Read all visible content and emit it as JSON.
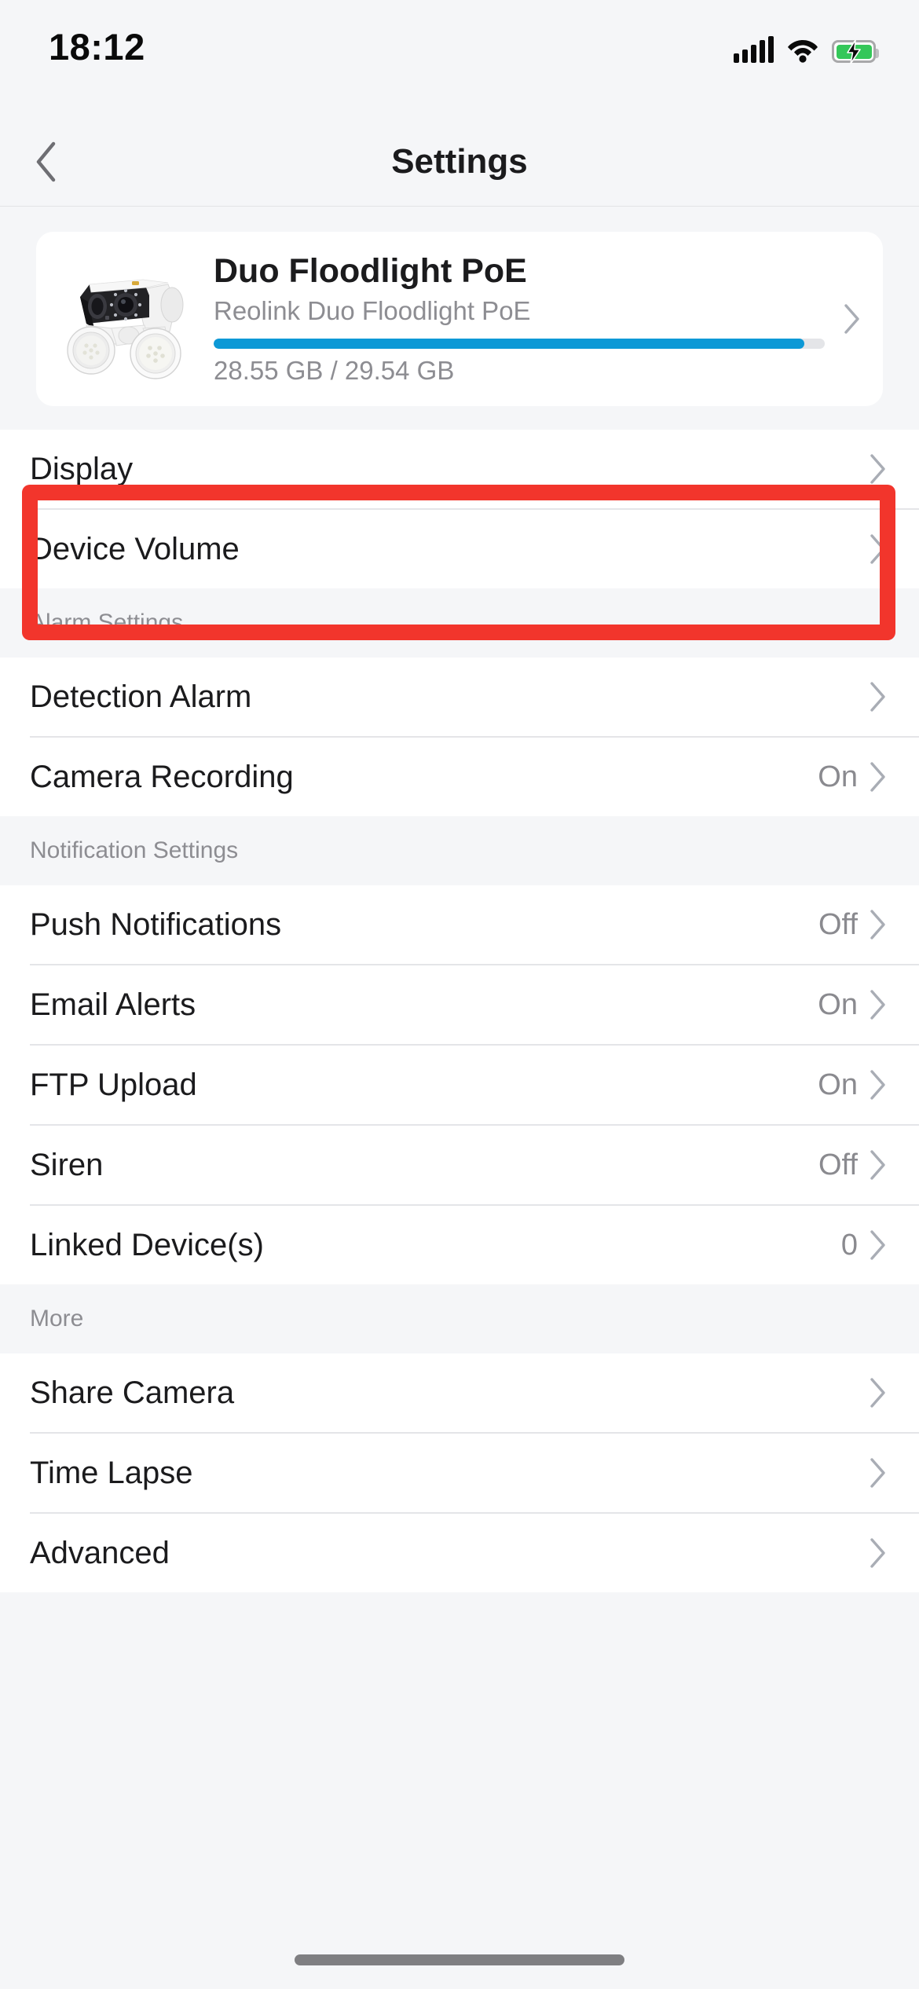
{
  "status_bar": {
    "time": "18:12",
    "signal_icon": "cellular-signal-icon",
    "wifi_icon": "wifi-icon",
    "battery_icon": "battery-charging-icon",
    "battery_color": "#34c759"
  },
  "navbar": {
    "back_icon": "chevron-left-icon",
    "title": "Settings"
  },
  "device_card": {
    "image_alt": "camera-thumbnail",
    "name": "Duo Floodlight PoE",
    "model": "Reolink Duo Floodlight PoE",
    "storage_used": "28.55 GB",
    "storage_total": "29.54 GB",
    "storage_text": "28.55 GB / 29.54 GB",
    "storage_percent": 96.6,
    "bar_color": "#0d99d6",
    "chevron_icon": "chevron-right-icon"
  },
  "highlight": {
    "color": "#f2352c",
    "target": "Display"
  },
  "sections": [
    {
      "header": null,
      "rows": [
        {
          "label": "Display",
          "value": "",
          "chevron_icon": "chevron-right-icon",
          "highlighted": true
        },
        {
          "label": "Device Volume",
          "value": "",
          "chevron_icon": "chevron-right-icon",
          "highlighted": false
        }
      ]
    },
    {
      "header": "Alarm Settings",
      "rows": [
        {
          "label": "Detection Alarm",
          "value": "",
          "chevron_icon": "chevron-right-icon",
          "highlighted": false
        },
        {
          "label": "Camera Recording",
          "value": "On",
          "chevron_icon": "chevron-right-icon",
          "highlighted": false
        }
      ]
    },
    {
      "header": "Notification Settings",
      "rows": [
        {
          "label": "Push Notifications",
          "value": "Off",
          "chevron_icon": "chevron-right-icon",
          "highlighted": false
        },
        {
          "label": "Email Alerts",
          "value": "On",
          "chevron_icon": "chevron-right-icon",
          "highlighted": false
        },
        {
          "label": "FTP Upload",
          "value": "On",
          "chevron_icon": "chevron-right-icon",
          "highlighted": false
        },
        {
          "label": "Siren",
          "value": "Off",
          "chevron_icon": "chevron-right-icon",
          "highlighted": false
        },
        {
          "label": "Linked Device(s)",
          "value": "0",
          "chevron_icon": "chevron-right-icon",
          "highlighted": false
        }
      ]
    },
    {
      "header": "More",
      "rows": [
        {
          "label": "Share Camera",
          "value": "",
          "chevron_icon": "chevron-right-icon",
          "highlighted": false
        },
        {
          "label": "Time Lapse",
          "value": "",
          "chevron_icon": "chevron-right-icon",
          "highlighted": false
        },
        {
          "label": "Advanced",
          "value": "",
          "chevron_icon": "chevron-right-icon",
          "highlighted": false
        }
      ]
    }
  ],
  "home_indicator": "home-indicator"
}
